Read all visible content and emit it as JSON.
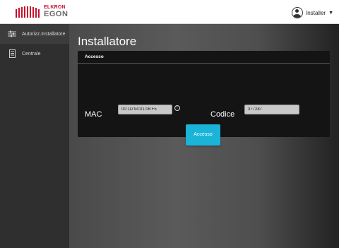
{
  "logo": {
    "top": "ELKRON",
    "bottom": "EGON"
  },
  "user": {
    "name": "Installer"
  },
  "sidebar": {
    "items": [
      {
        "label": "Autorizz.Installatore",
        "icon": "sliders-icon"
      },
      {
        "label": "Centrale",
        "icon": "panel-device-icon"
      }
    ]
  },
  "main": {
    "title": "Installatore",
    "panel": {
      "header": "Accesso",
      "mac_label": "MAC",
      "mac_value": "00:1D:94:01:06:F5",
      "code_label": "Codice",
      "code_value": "377287"
    },
    "button_label": "Accesso"
  },
  "colors": {
    "accent": "#1ab4d8",
    "brand": "#c8102e"
  }
}
